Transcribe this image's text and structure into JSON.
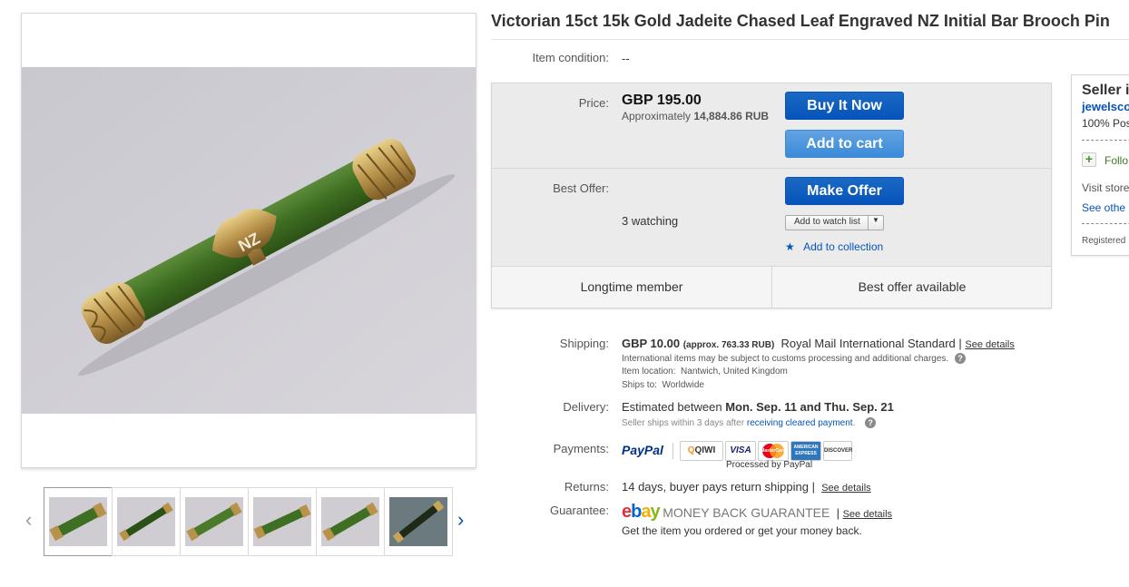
{
  "title": "Victorian 15ct 15k Gold Jadeite Chased Leaf Engraved NZ Initial Bar Brooch Pin",
  "condition": {
    "label": "Item condition:",
    "value": "--"
  },
  "price": {
    "label": "Price:",
    "amount": "GBP 195.00",
    "approx_prefix": "Approximately",
    "approx_value": "14,884.86 RUB"
  },
  "buttons": {
    "buy_now": "Buy It Now",
    "add_to_cart": "Add to cart",
    "make_offer": "Make Offer",
    "watch_list": "Add to watch list",
    "collection": "Add to collection"
  },
  "best_offer": {
    "label": "Best Offer:",
    "watching": "3 watching"
  },
  "highlights": [
    "Longtime member",
    "Best offer available"
  ],
  "seller": {
    "heading": "Seller i",
    "name": "jewelsco",
    "positive": "100% Pos",
    "follow": "Follo",
    "visit_store": "Visit store",
    "see_other": "See othe",
    "registered": "Registered"
  },
  "shipping": {
    "label": "Shipping:",
    "amount": "GBP 10.00",
    "approx": "(approx. 763.33 RUB)",
    "service": "Royal Mail International Standard",
    "separator": "|",
    "see_details": "See details",
    "customs_note": "International items may be subject to customs processing and additional charges.",
    "location_label": "Item location:",
    "location": "Nantwich, United Kingdom",
    "ships_to_label": "Ships to:",
    "ships_to": "Worldwide"
  },
  "delivery": {
    "label": "Delivery:",
    "prefix": "Estimated between",
    "range": "Mon. Sep. 11 and Thu. Sep. 21",
    "note_prefix": "Seller ships within 3 days after",
    "note_link": "receiving cleared payment",
    "note_suffix": "."
  },
  "payments": {
    "label": "Payments:",
    "paypal": "PayPal",
    "qiwi": "QIWI",
    "visa": "VISA",
    "mastercard": "MasterCard",
    "amex": "AMERICAN EXPRESS",
    "discover": "DISCOVER",
    "processed": "Processed by PayPal"
  },
  "returns": {
    "label": "Returns:",
    "text": "14 days, buyer pays return shipping",
    "separator": "|",
    "see_details": "See details"
  },
  "guarantee": {
    "label": "Guarantee:",
    "logo_e": "e",
    "logo_b": "b",
    "logo_a": "a",
    "logo_y": "y",
    "mbg": "MONEY BACK GUARANTEE",
    "separator": "|",
    "see_details": "See details",
    "text": "Get the item you ordered or get your money back."
  },
  "colors": {
    "link": "#0654ba",
    "button": "#0654ba",
    "paypal_blue": "#003087",
    "paypal_light": "#009cde"
  },
  "icons": [
    "chevron-left-icon",
    "chevron-right-icon",
    "star-icon",
    "plus-icon",
    "help-icon",
    "dropdown-arrow-icon"
  ]
}
